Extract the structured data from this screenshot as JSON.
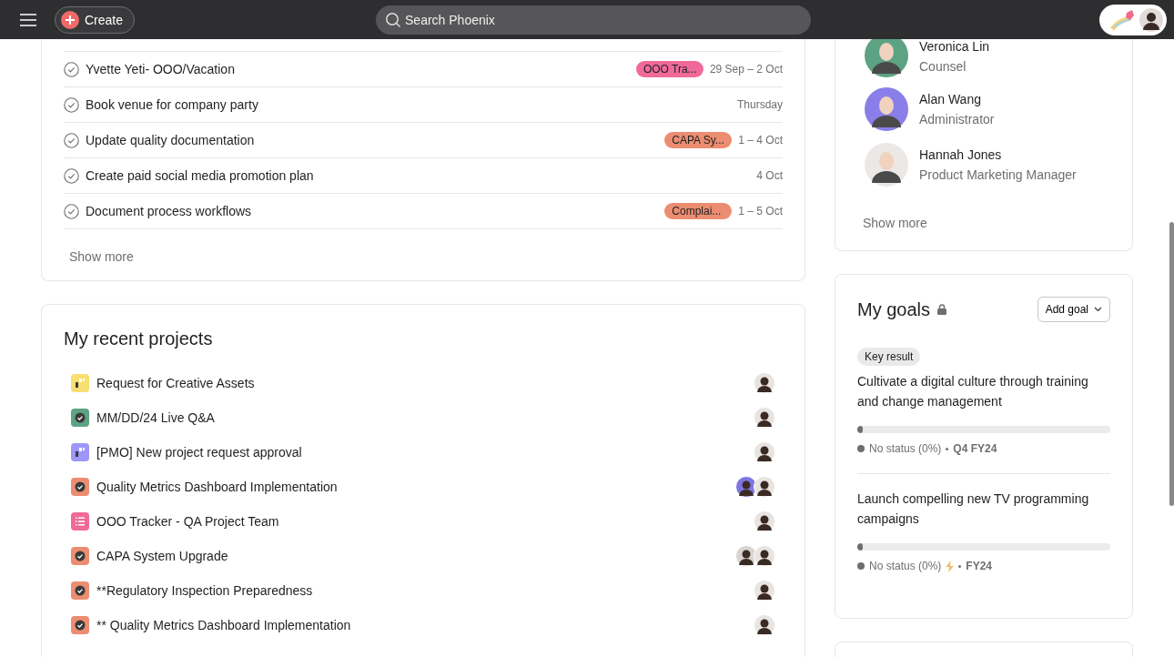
{
  "topbar": {
    "create": "Create",
    "search": {
      "placeholder": "Search Phoenix"
    }
  },
  "tasks": {
    "rows": [
      {
        "name": "Yvette Yeti- OOO/Vacation",
        "tag": {
          "label": "OOO Tra...",
          "color": "#f06a99"
        },
        "date": "29 Sep – 2 Oct"
      },
      {
        "name": "Book venue for company party",
        "date": "Thursday"
      },
      {
        "name": "Update quality documentation",
        "tag": {
          "label": "CAPA Sy...",
          "color": "#ec8d71"
        },
        "date": "1 – 4 Oct"
      },
      {
        "name": "Create paid social media promotion plan",
        "date": "4 Oct"
      },
      {
        "name": "Document process workflows",
        "tag": {
          "label": "Complai...",
          "color": "#ec8d71"
        },
        "date": "1 – 5 Oct"
      }
    ],
    "show_more": "Show more"
  },
  "projects": {
    "title": "My recent projects",
    "rows": [
      {
        "name": "Request for Creative Assets",
        "kind": "board",
        "color": "#f8df72",
        "avatars": [
          {
            "color": "#e8e4e2"
          }
        ]
      },
      {
        "name": "MM/DD/24 Live Q&A",
        "kind": "check",
        "color": "#5da283",
        "avatars": [
          {
            "color": "#e8e4e2"
          }
        ]
      },
      {
        "name": "[PMO] New project request approval",
        "kind": "board",
        "color": "#9e97f7",
        "avatars": [
          {
            "color": "#e8e4e2"
          }
        ]
      },
      {
        "name": "Quality Metrics Dashboard Implementation",
        "kind": "check",
        "color": "#ec8d71",
        "avatars": [
          {
            "color": "#7f75e0"
          },
          {
            "color": "#e8e4e2"
          }
        ]
      },
      {
        "name": "OOO Tracker - QA Project Team",
        "kind": "list",
        "color": "#f06a99",
        "avatars": [
          {
            "color": "#e8e4e2"
          }
        ]
      },
      {
        "name": "CAPA System Upgrade",
        "kind": "check",
        "color": "#ec8d71",
        "avatars": [
          {
            "color": "#d9d4d2"
          },
          {
            "color": "#e8e4e2"
          }
        ]
      },
      {
        "name": "**Regulatory Inspection Preparedness",
        "kind": "check",
        "color": "#ec8d71",
        "avatars": [
          {
            "color": "#e8e4e2"
          }
        ]
      },
      {
        "name": "** Quality Metrics Dashboard Implementation",
        "kind": "check",
        "color": "#ec8d71",
        "avatars": [
          {
            "color": "#e8e4e2"
          }
        ]
      }
    ]
  },
  "people": {
    "items": [
      {
        "name": "Veronica Lin",
        "role": "Counsel",
        "color": "#5da283"
      },
      {
        "name": "Alan Wang",
        "role": "Administrator",
        "color": "#8a7fe8"
      },
      {
        "name": "Hannah Jones",
        "role": "Product Marketing Manager",
        "color": "#ece8e6"
      }
    ],
    "show_more": "Show more"
  },
  "goals": {
    "title": "My goals",
    "add": "Add goal",
    "items": [
      {
        "badge": "Key result",
        "name": "Cultivate a digital culture through training and change management",
        "level": 0,
        "status": "No status (0%)",
        "bolt": false,
        "period": "Q4 FY24"
      },
      {
        "name": "Launch compelling new TV programming campaigns",
        "level": 0,
        "status": "No status (0%)",
        "bolt": true,
        "period": "FY24"
      }
    ]
  }
}
